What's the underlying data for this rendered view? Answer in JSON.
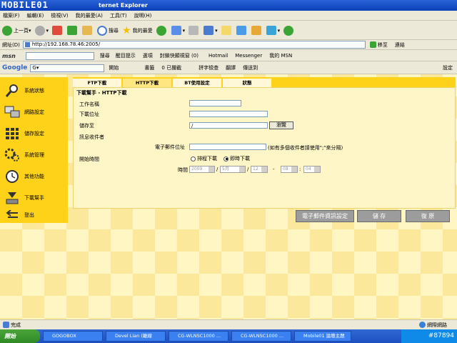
{
  "window": {
    "watermark": "MOBILE01",
    "title": "ternet Explorer"
  },
  "menubar": [
    "檔案(F)",
    "編輯(E)",
    "檢視(V)",
    "我的最愛(A)",
    "工具(T)",
    "說明(H)"
  ],
  "toolbar": {
    "back": "上一頁",
    "search": "搜尋",
    "favorites": "我的最愛"
  },
  "address": {
    "label": "網址(D)",
    "url": "http://192.168.78.46:2005/",
    "go": "移至",
    "links": "連結"
  },
  "msnbar": {
    "logo": "msn",
    "search": "搜尋",
    "highlight": "醒目提示",
    "options": "選項",
    "block": "封鎖快顯視窗 (0)",
    "hotmail": "Hotmail",
    "messenger": "Messenger",
    "mymsn": "我的 MSN"
  },
  "googlebar": {
    "logo": "Google",
    "prefix": "G",
    "start": "開始",
    "bookmarks": "書籤",
    "blocked": "0 已攔截",
    "spell": "拼字檢查",
    "translate": "翻譯",
    "sendto": "傳送到",
    "settings": "設定"
  },
  "sidebar": [
    {
      "label": "系統狀態"
    },
    {
      "label": "網路設定"
    },
    {
      "label": "儲存設定"
    },
    {
      "label": "系統管理"
    },
    {
      "label": "其他功能"
    },
    {
      "label": "下載幫手"
    },
    {
      "label": "登出"
    }
  ],
  "tabs": [
    "FTP下載",
    "HTTP下載",
    "BT使用設定",
    "狀態"
  ],
  "form": {
    "heading": "下載幫手 - HTTP下載",
    "task_name_label": "工作名稱",
    "url_label": "下載位址",
    "save_to_label": "儲存至",
    "save_to_value": "/",
    "browse": "瀏覽",
    "notify_label": "訊息收件者",
    "email_label": "電子郵件位址",
    "email_hint": "(如有多個收件者請使用\";\"來分隔)",
    "start_label": "開始時間",
    "radio_schedule": "排程下載",
    "radio_now": "即時下載",
    "time_label": "時間",
    "year": "2009",
    "month": "5月",
    "day": "12",
    "hour": "08",
    "minute": "04"
  },
  "buttons": {
    "email_settings": "電子郵件資訊設定",
    "save": "儲 存",
    "restore": "復 原"
  },
  "status": {
    "text": "完成",
    "zone": "網際網路"
  },
  "taskbar": {
    "start": "開始",
    "tasks": [
      "GOGOBOX",
      "Devel Lian (離線",
      "CG-WLNSC1000 ...",
      "CG-WLNSC1000 ...",
      "Mobile01 論壇主題"
    ],
    "tray": "#87894"
  }
}
